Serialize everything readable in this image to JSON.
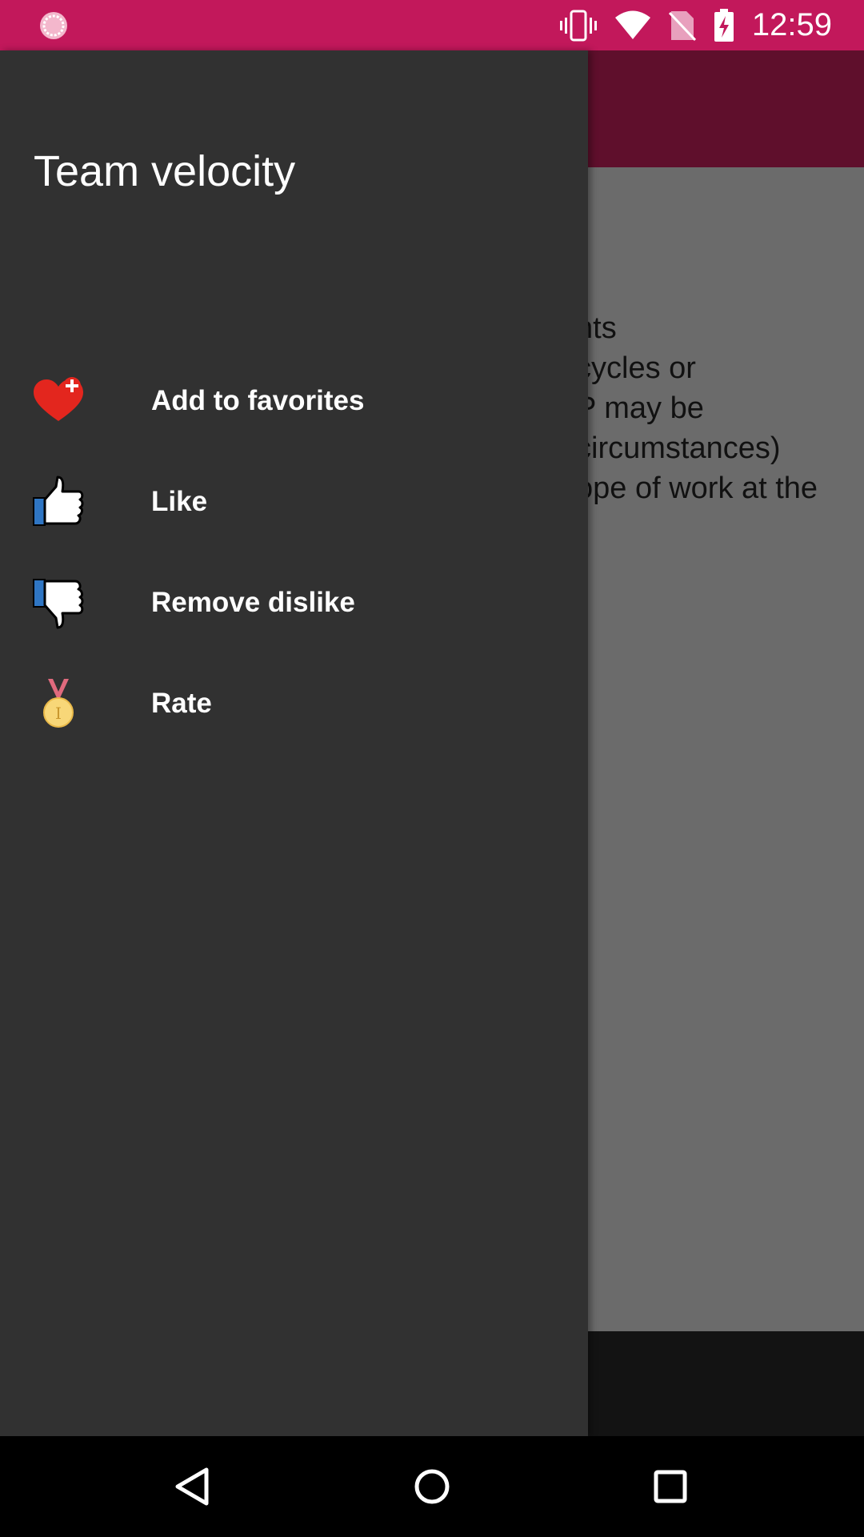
{
  "status_bar": {
    "time": "12:59",
    "icons": [
      "app-notification-icon",
      "vibrate-icon",
      "wifi-icon",
      "no-sim-icon",
      "battery-charging-icon"
    ]
  },
  "app": {
    "content_lines": [
      "nts",
      " cycles or",
      "P may be",
      "circumstances)",
      "ope of work at the"
    ]
  },
  "drawer": {
    "title": "Team velocity",
    "items": [
      {
        "label": "Add to favorites",
        "icon": "heart-plus-icon"
      },
      {
        "label": "Like",
        "icon": "thumbs-up-icon"
      },
      {
        "label": "Remove dislike",
        "icon": "thumbs-down-icon"
      },
      {
        "label": "Rate",
        "icon": "medal-icon"
      }
    ]
  },
  "nav_bar": {
    "buttons": [
      "back-icon",
      "home-icon",
      "recents-icon"
    ]
  },
  "colors": {
    "status_bar": "#c2185b",
    "toolbar_dimmed": "#5f0f2c",
    "drawer_bg": "#313131",
    "content_dimmed": "#6b6b6b"
  }
}
